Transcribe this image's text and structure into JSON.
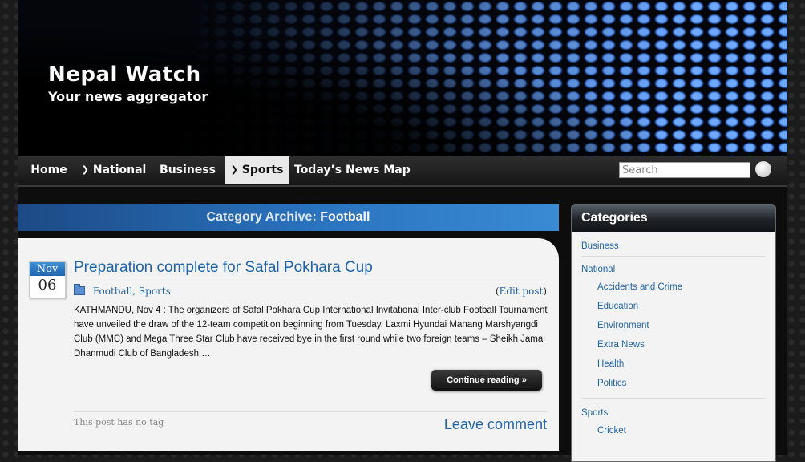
{
  "site": {
    "title": "Nepal Watch",
    "description": "Your news aggregator"
  },
  "nav": {
    "items": [
      {
        "label": "Home",
        "dropdown": false,
        "active": false
      },
      {
        "label": "National",
        "dropdown": true,
        "active": false
      },
      {
        "label": "Business",
        "dropdown": false,
        "active": false
      },
      {
        "label": "Sports",
        "dropdown": true,
        "active": true
      },
      {
        "label": "Today’s News Map",
        "dropdown": false,
        "active": false
      }
    ],
    "search_placeholder": "Search",
    "search_icon": "search-icon"
  },
  "archive": {
    "prefix": "Category Archive:",
    "name": "Football"
  },
  "post": {
    "date_month": "Nov",
    "date_day": "06",
    "title": "Preparation complete for Safal Pokhara Cup",
    "categories": [
      "Football",
      "Sports"
    ],
    "edit_link": "Edit post",
    "excerpt": "KATHMANDU, Nov 4 : The organizers of Safal Pokhara Cup International Invitational Inter-club Football Tournament have unveiled the draw of the 12-team competition beginning from Tuesday. Laxmi Hyundai Manang Marshyangdi Club (MMC) and Mega Three Star Club have received bye in the first round while two foreign teams – Sheikh Jamal Dhanmudi Club of Bangladesh …",
    "continue_label": "Continue reading »",
    "no_tag": "This post has no tag",
    "comment_label": "Leave comment"
  },
  "sidebar": {
    "heading": "Categories",
    "groups": [
      {
        "label": "Business",
        "children": []
      },
      {
        "label": "National",
        "children": [
          "Accidents and Crime",
          "Education",
          "Environment",
          "Extra News",
          "Health",
          "Politics"
        ]
      },
      {
        "label": "Sports",
        "children": [
          "Cricket"
        ]
      }
    ]
  },
  "colors": {
    "link": "#1f64a8",
    "archive_bar": "#2a73bf",
    "nav_bg": "#222222"
  }
}
